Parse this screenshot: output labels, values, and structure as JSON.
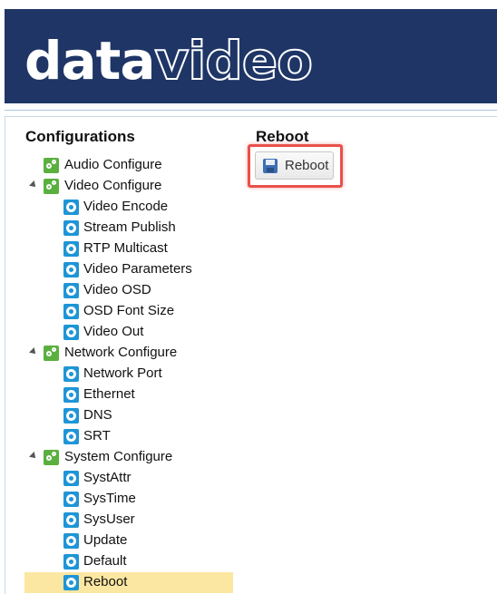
{
  "brand": {
    "logo_part1": "data",
    "logo_part2": "video",
    "header_color": "#1e3566"
  },
  "sidebar": {
    "title": "Configurations",
    "items": [
      {
        "label": "Audio Configure",
        "level": 1,
        "icon": "green-gear-icon",
        "expandable": false
      },
      {
        "label": "Video Configure",
        "level": 1,
        "icon": "green-gear-icon",
        "expandable": true,
        "expanded": true
      },
      {
        "label": "Video Encode",
        "level": 2,
        "icon": "blue-gear-icon"
      },
      {
        "label": "Stream Publish",
        "level": 2,
        "icon": "blue-gear-icon"
      },
      {
        "label": "RTP Multicast",
        "level": 2,
        "icon": "blue-gear-icon"
      },
      {
        "label": "Video Parameters",
        "level": 2,
        "icon": "blue-gear-icon"
      },
      {
        "label": "Video OSD",
        "level": 2,
        "icon": "blue-gear-icon"
      },
      {
        "label": "OSD Font Size",
        "level": 2,
        "icon": "blue-gear-icon"
      },
      {
        "label": "Video Out",
        "level": 2,
        "icon": "blue-gear-icon"
      },
      {
        "label": "Network Configure",
        "level": 1,
        "icon": "green-gear-icon",
        "expandable": true,
        "expanded": true
      },
      {
        "label": "Network Port",
        "level": 2,
        "icon": "blue-gear-icon"
      },
      {
        "label": "Ethernet",
        "level": 2,
        "icon": "blue-gear-icon"
      },
      {
        "label": "DNS",
        "level": 2,
        "icon": "blue-gear-icon"
      },
      {
        "label": "SRT",
        "level": 2,
        "icon": "blue-gear-icon"
      },
      {
        "label": "System Configure",
        "level": 1,
        "icon": "green-gear-icon",
        "expandable": true,
        "expanded": true
      },
      {
        "label": "SystAttr",
        "level": 2,
        "icon": "blue-gear-icon"
      },
      {
        "label": "SysTime",
        "level": 2,
        "icon": "blue-gear-icon"
      },
      {
        "label": "SysUser",
        "level": 2,
        "icon": "blue-gear-icon"
      },
      {
        "label": "Update",
        "level": 2,
        "icon": "blue-gear-icon"
      },
      {
        "label": "Default",
        "level": 2,
        "icon": "blue-gear-icon"
      },
      {
        "label": "Reboot",
        "level": 2,
        "icon": "blue-gear-icon",
        "selected": true
      }
    ],
    "selected_color": "#fce7a2"
  },
  "main": {
    "title": "Reboot",
    "reboot_button_label": "Reboot",
    "highlight_color": "#e8514a"
  }
}
